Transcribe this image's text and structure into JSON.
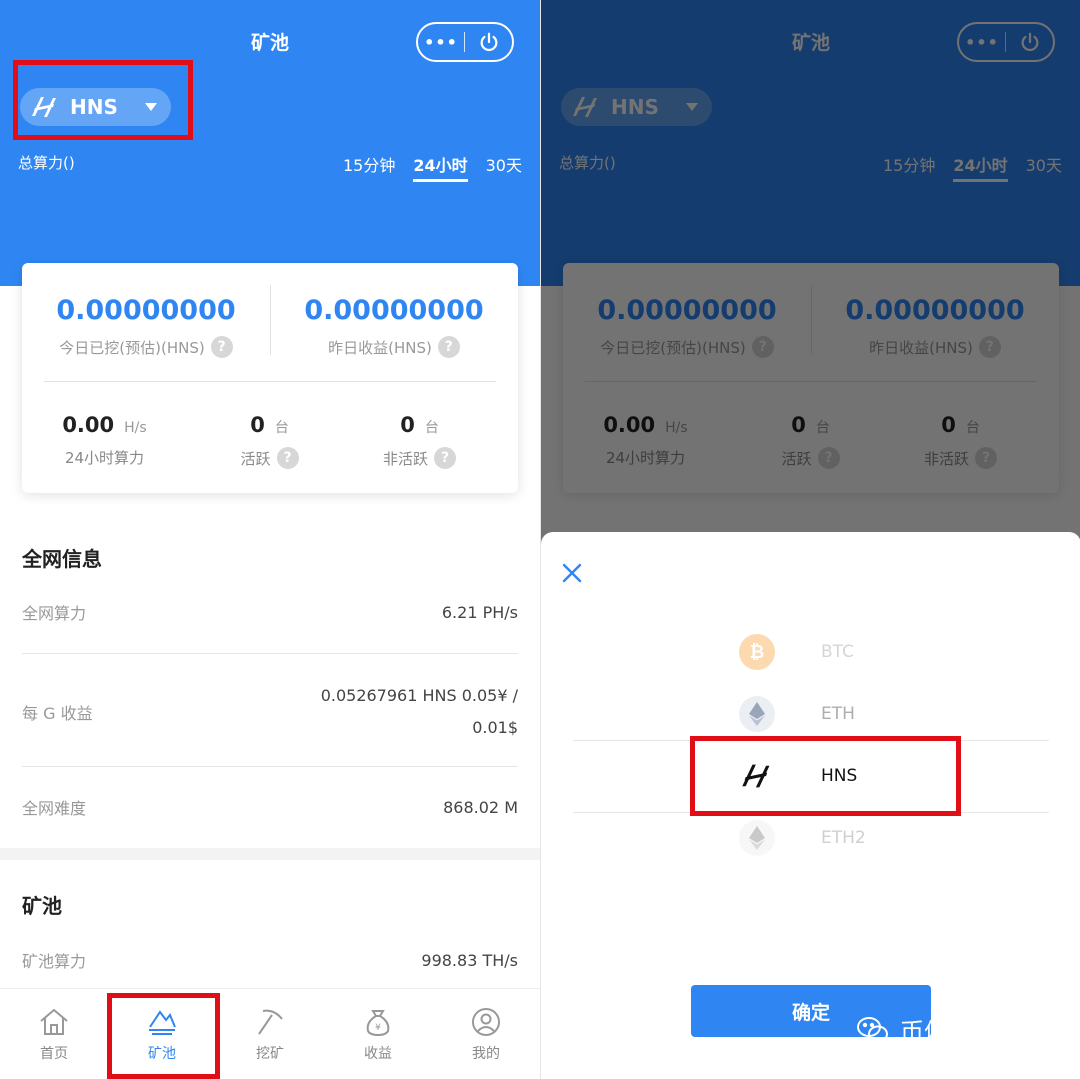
{
  "pool": {
    "title": "矿池",
    "capsule_more": "•••",
    "coin": "HNS",
    "hashrate_label": "总算力()",
    "ranges": [
      "15分钟",
      "24小时",
      "30天"
    ],
    "active_range": "24小时",
    "today_value": "0.00000000",
    "today_label": "今日已挖(预估)(HNS)",
    "yesterday_value": "0.00000000",
    "yesterday_label": "昨日收益(HNS)",
    "hash24_value": "0.00",
    "hash24_unit": "H/s",
    "hash24_label": "24小时算力",
    "active_value": "0",
    "active_unit": "台",
    "active_label": "活跃",
    "inactive_value": "0",
    "inactive_unit": "台",
    "inactive_label": "非活跃",
    "help": "?"
  },
  "network": {
    "title": "全网信息",
    "hashrate_label": "全网算力",
    "hashrate_value": "6.21 PH/s",
    "per_g_label": "每 G 收益",
    "per_g_value_line1": "0.05267961 HNS 0.05¥ /",
    "per_g_value_line2": "0.01$",
    "difficulty_label": "全网难度",
    "difficulty_value": "868.02 M"
  },
  "pool_section": {
    "title": "矿池",
    "hashrate_label": "矿池算力",
    "hashrate_value": "998.83 TH/s"
  },
  "tabbar": {
    "home": "首页",
    "pool": "矿池",
    "mining": "挖矿",
    "income": "收益",
    "mine": "我的"
  },
  "picker": {
    "options": [
      "BTC",
      "ETH",
      "HNS",
      "ETH2"
    ],
    "selected": "HNS",
    "confirm": "确定"
  },
  "watermark": "币信可乐矿池",
  "colors": {
    "primary": "#2f86f3",
    "highlight": "#e10e17"
  }
}
